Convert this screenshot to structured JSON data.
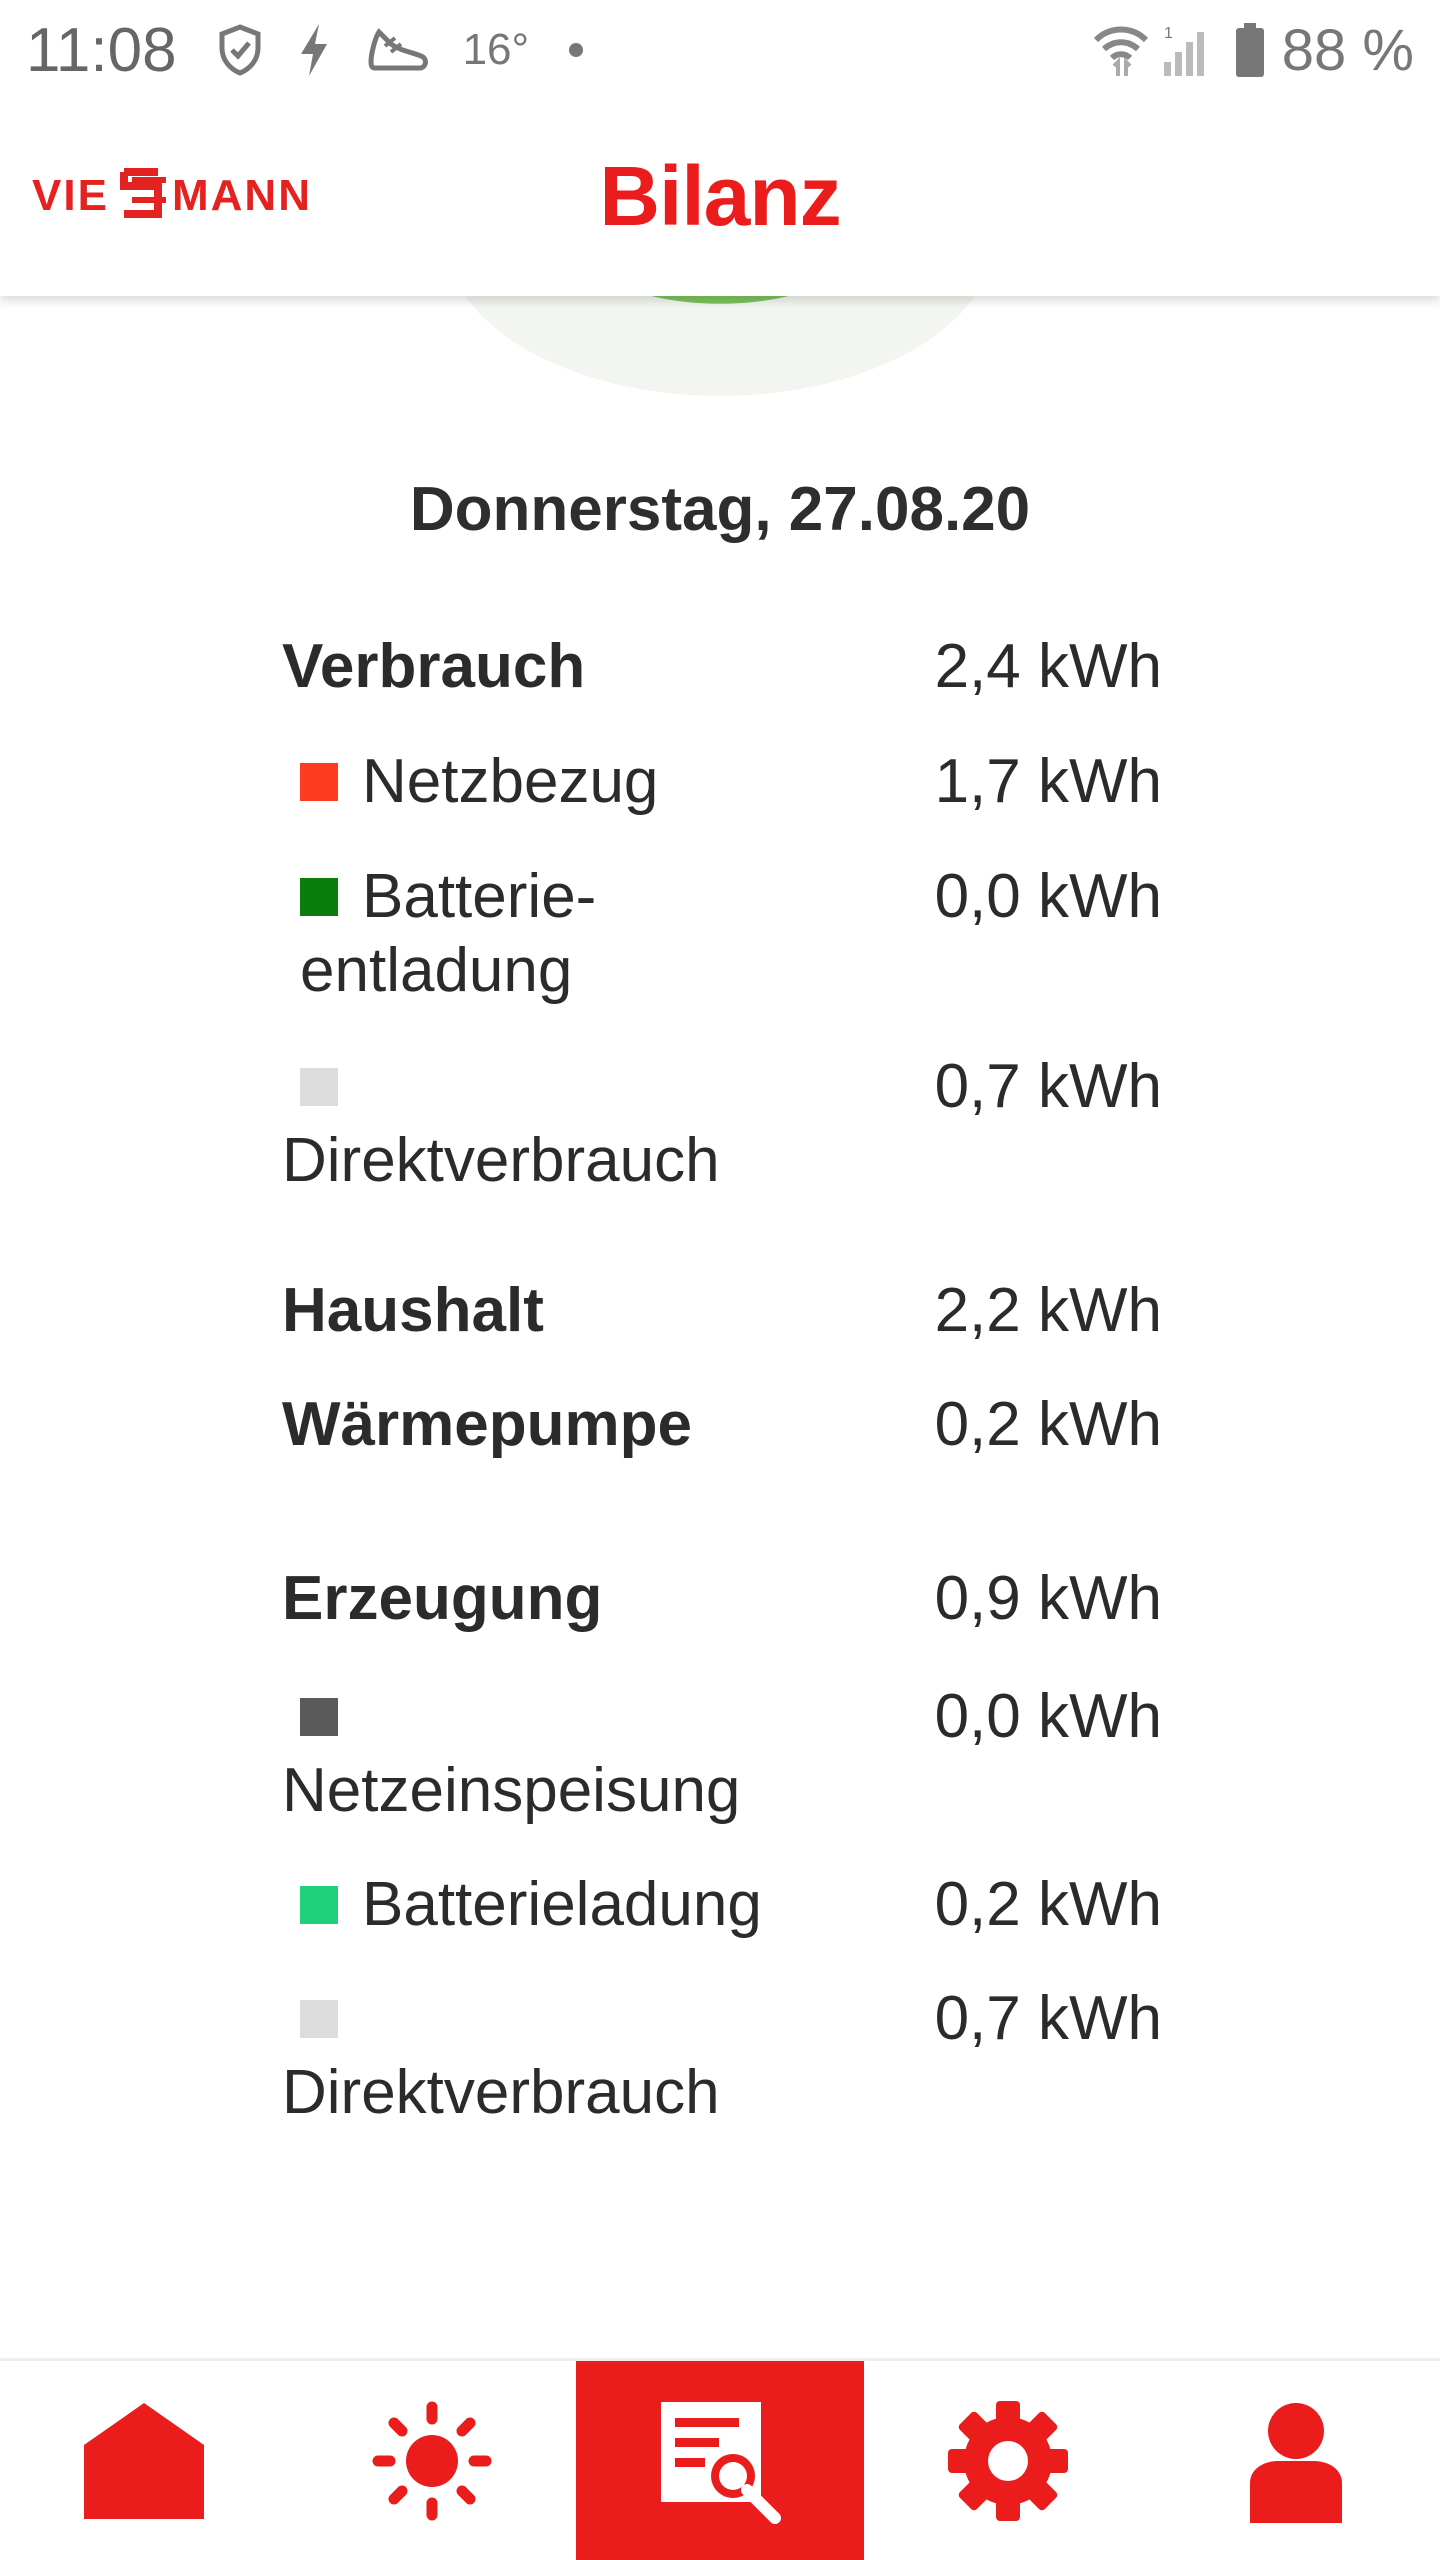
{
  "status_bar": {
    "time": "11:08",
    "temperature": "16°",
    "battery": "88 %",
    "icons": [
      "shield-icon",
      "bolt-icon",
      "shoe-icon",
      "dot-icon",
      "wifi-icon",
      "signal-icon",
      "battery-icon"
    ]
  },
  "header": {
    "logo_text": "VIESSMANN",
    "title": "Bilanz"
  },
  "date": "Donnerstag, 27.08.20",
  "consumption": {
    "title": "Verbrauch",
    "total": "2,4 kWh",
    "items": [
      {
        "label": "Netzbezug",
        "value": "1,7 kWh",
        "color": "#ff3b1f"
      },
      {
        "label_1": "Batterie-",
        "label_2": "entladung",
        "value": "0,0 kWh",
        "color": "#0a7d0a"
      },
      {
        "label": "Direktverbrauch",
        "value": "0,7 kWh",
        "color": "#dcdcdc"
      }
    ]
  },
  "household": {
    "label": "Haushalt",
    "value": "2,2 kWh"
  },
  "heatpump": {
    "label": "Wärmepumpe",
    "value": "0,2 kWh"
  },
  "production": {
    "title": "Erzeugung",
    "total": "0,9 kWh",
    "items": [
      {
        "label": "Netzeinspeisung",
        "value": "0,0 kWh",
        "color": "#5a5a5a"
      },
      {
        "label": "Batterieladung",
        "value": "0,2 kWh",
        "color": "#1fd27a"
      },
      {
        "label": "Direktverbrauch",
        "value": "0,7 kWh",
        "color": "#dcdcdc"
      }
    ]
  },
  "nav": {
    "items": [
      "home-icon",
      "sun-icon",
      "report-search-icon",
      "gear-icon",
      "user-icon"
    ],
    "active_index": 2
  },
  "colors": {
    "accent": "#ea1c1c",
    "gauge_green": "#7dc35b",
    "gauge_bg": "#f1f4ee"
  }
}
